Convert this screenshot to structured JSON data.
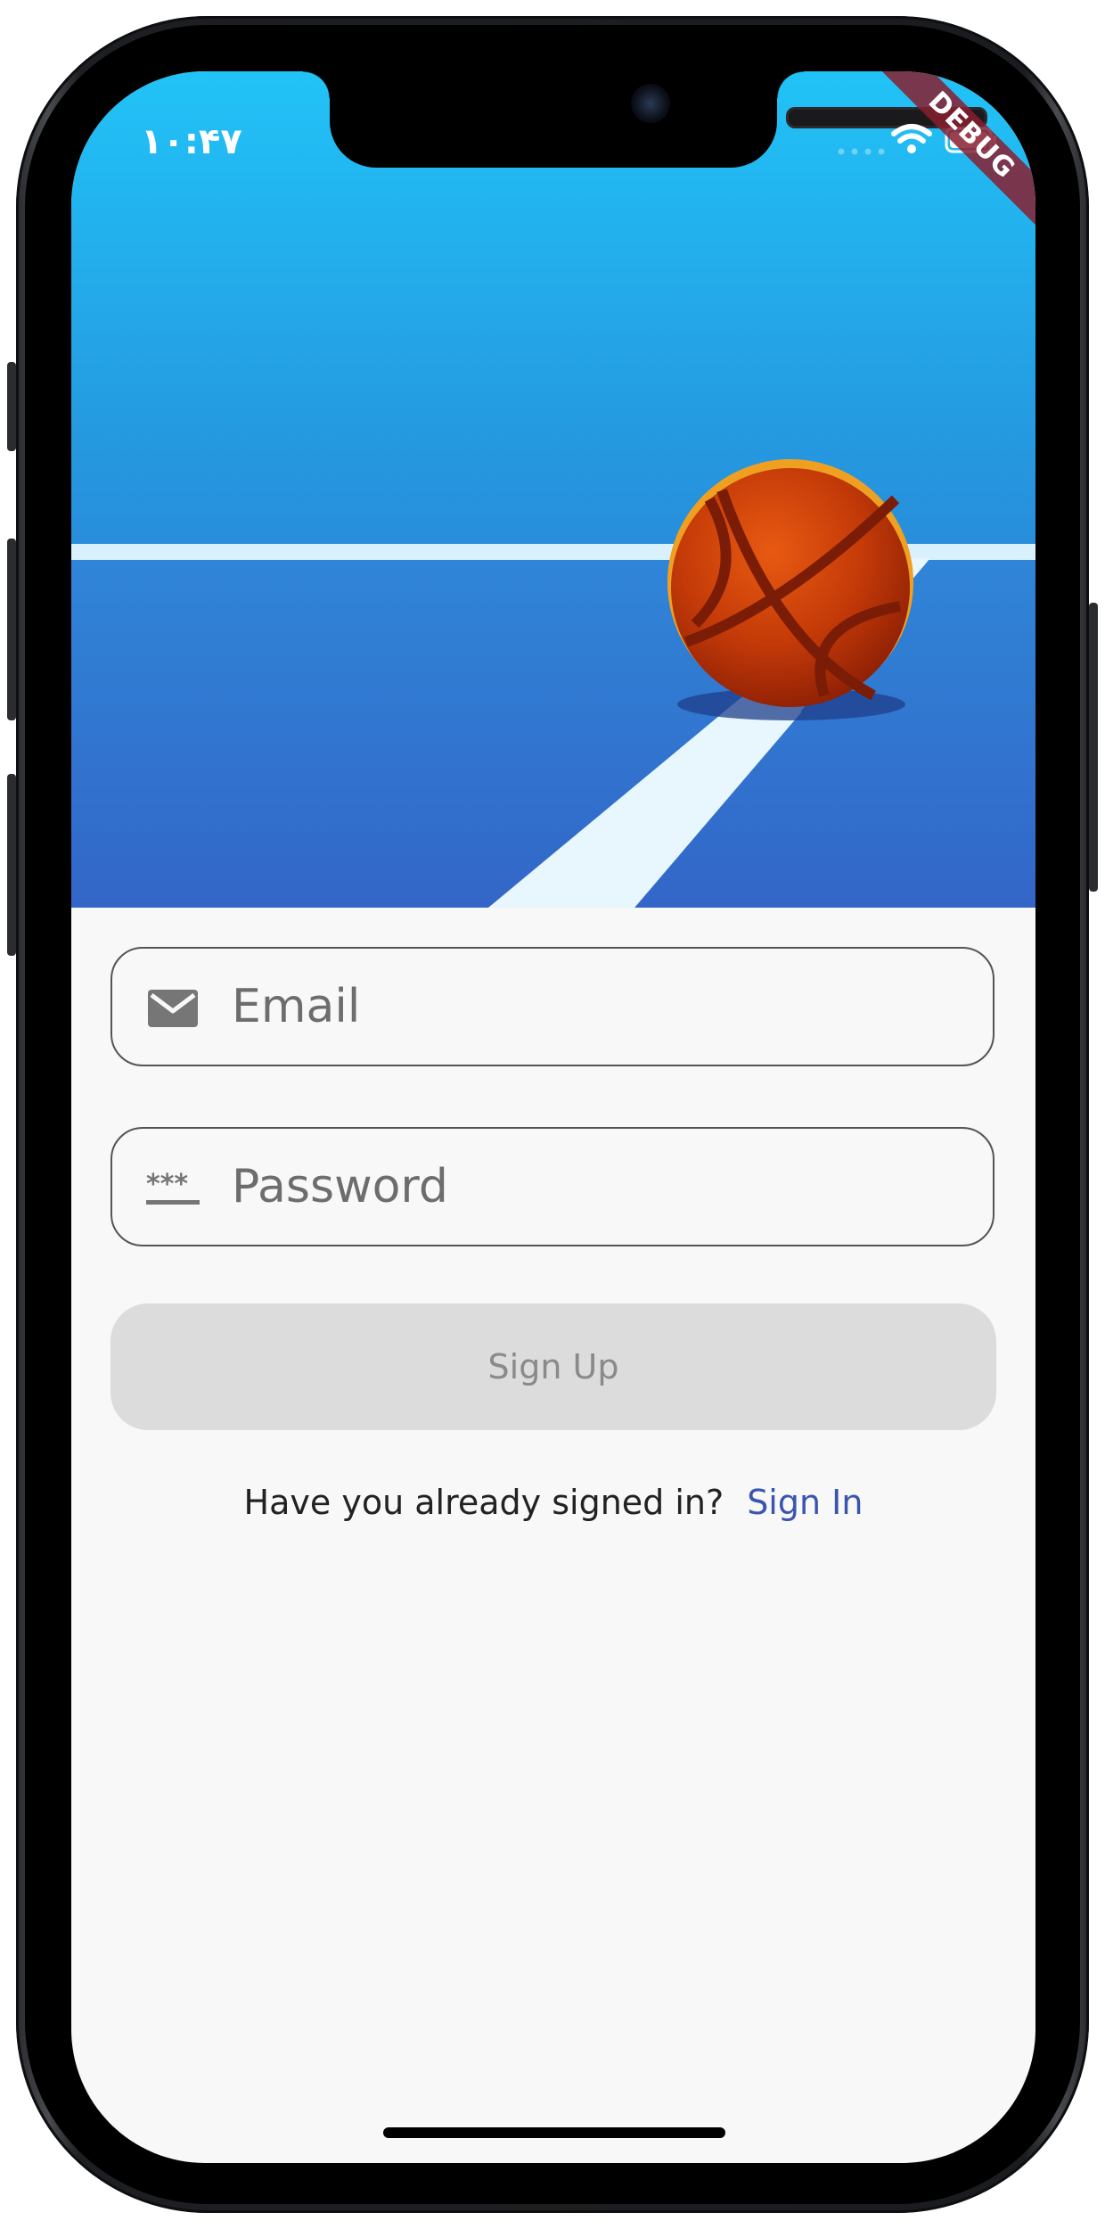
{
  "status_bar": {
    "time": "۱۰:۴۷",
    "debug_label": "DEBUG"
  },
  "form": {
    "email": {
      "placeholder": "Email",
      "value": ""
    },
    "password": {
      "placeholder": "Password",
      "value": ""
    },
    "signup_label": "Sign Up",
    "signin_prompt": "Have you already signed in?",
    "signin_link": "Sign In"
  },
  "icons": {
    "email": "mail-icon",
    "password": "password-icon",
    "wifi": "wifi-icon",
    "battery": "battery-icon"
  },
  "colors": {
    "hero_top": "#21c3f7",
    "hero_bottom": "#3267c7",
    "link": "#3a55b0",
    "button_disabled": "#dcdcdc",
    "debug_banner": "#881e2f"
  }
}
